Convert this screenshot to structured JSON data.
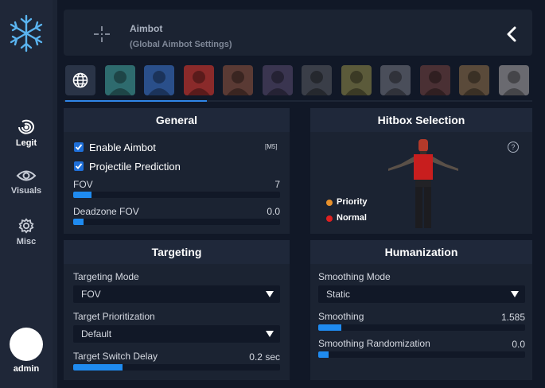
{
  "sidebar": {
    "items": [
      {
        "label": "Legit",
        "icon": "target-icon"
      },
      {
        "label": "Visuals",
        "icon": "eye-icon"
      },
      {
        "label": "Misc",
        "icon": "gear-icon"
      }
    ],
    "user": "admin"
  },
  "header": {
    "title": "Aimbot",
    "subtitle": "(Global Aimbot Settings)"
  },
  "tabs": [
    {
      "icon": "globe-icon",
      "active": true,
      "color": "#2a3447"
    },
    {
      "icon": "hero-portrait-icon",
      "color": "#2e6b6e"
    },
    {
      "icon": "hero-portrait-icon",
      "color": "#2a4f8a"
    },
    {
      "icon": "hero-portrait-icon",
      "color": "#8a2a2a"
    },
    {
      "icon": "hero-portrait-icon",
      "color": "#5a3a34"
    },
    {
      "icon": "hero-portrait-icon",
      "color": "#3a3550"
    },
    {
      "icon": "hero-portrait-icon",
      "color": "#3a3e48"
    },
    {
      "icon": "hero-portrait-icon",
      "color": "#5b5a3a"
    },
    {
      "icon": "hero-portrait-icon",
      "color": "#4a4e5a"
    },
    {
      "icon": "hero-portrait-icon",
      "color": "#4a3034"
    },
    {
      "icon": "hero-portrait-icon",
      "color": "#5a4a3a"
    },
    {
      "icon": "hero-portrait-icon",
      "color": "#6a6a70"
    }
  ],
  "general": {
    "title": "General",
    "enable_aimbot": {
      "label": "Enable Aimbot",
      "checked": true,
      "keybind": "[M5]"
    },
    "projectile_prediction": {
      "label": "Projectile Prediction",
      "checked": true
    },
    "fov": {
      "label": "FOV",
      "value": "7",
      "fraction": 0.09
    },
    "deadzone_fov": {
      "label": "Deadzone FOV",
      "value": "0.0",
      "fraction": 0.05
    }
  },
  "hitbox": {
    "title": "Hitbox Selection",
    "help": "?",
    "legend": [
      {
        "label": "Priority",
        "color": "#e8912c"
      },
      {
        "label": "Normal",
        "color": "#e02020"
      }
    ]
  },
  "targeting": {
    "title": "Targeting",
    "mode": {
      "label": "Targeting Mode",
      "value": "FOV"
    },
    "prioritization": {
      "label": "Target Prioritization",
      "value": "Default"
    },
    "switch_delay": {
      "label": "Target Switch Delay",
      "value": "0.2 sec",
      "fraction": 0.24
    }
  },
  "humanization": {
    "title": "Humanization",
    "smoothing_mode": {
      "label": "Smoothing Mode",
      "value": "Static"
    },
    "smoothing": {
      "label": "Smoothing",
      "value": "1.585",
      "fraction": 0.11
    },
    "smoothing_randomization": {
      "label": "Smoothing Randomization",
      "value": "0.0",
      "fraction": 0.05
    }
  },
  "colors": {
    "accent": "#1f8bf0",
    "background": "#111827",
    "panel": "#1b2332"
  }
}
